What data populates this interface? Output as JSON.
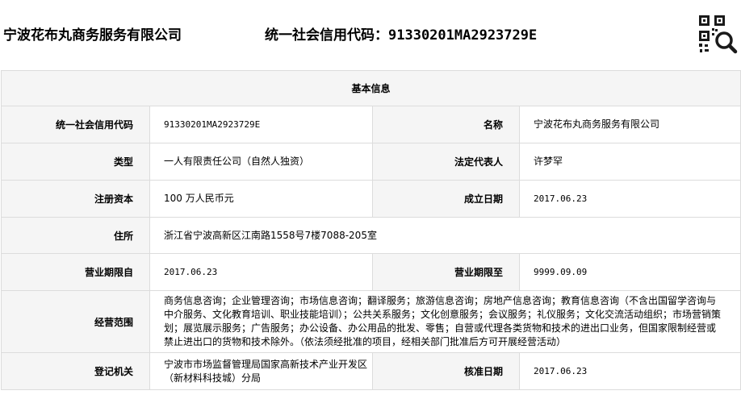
{
  "header": {
    "company_name": "宁波花布丸商务服务有限公司",
    "credit_label": "统一社会信用代码：",
    "credit_code": "91330201MA2923729E",
    "qr_icon": "qr-code-search-icon"
  },
  "table": {
    "title": "基本信息",
    "credit_code": {
      "label": "统一社会信用代码",
      "value": "91330201MA2923729E"
    },
    "name": {
      "label": "名称",
      "value": "宁波花布丸商务服务有限公司"
    },
    "type": {
      "label": "类型",
      "value": "一人有限责任公司（自然人独资）"
    },
    "legal_rep": {
      "label": "法定代表人",
      "value": "许梦罕"
    },
    "reg_capital": {
      "label": "注册资本",
      "value": "100 万人民币元"
    },
    "founded": {
      "label": "成立日期",
      "value": "2017.06.23"
    },
    "address": {
      "label": "住所",
      "value": "浙江省宁波高新区江南路1558号7楼7088-205室"
    },
    "term_from": {
      "label": "营业期限自",
      "value": "2017.06.23"
    },
    "term_to": {
      "label": "营业期限至",
      "value": "9999.09.09"
    },
    "scope": {
      "label": "经营范围",
      "value": "商务信息咨询；企业管理咨询；市场信息咨询；翻译服务；旅游信息咨询；房地产信息咨询；教育信息咨询（不含出国留学咨询与中介服务、文化教育培训、职业技能培训）；公共关系服务；文化创意服务；会议服务；礼仪服务；文化交流活动组织；市场营销策划；展览展示服务；广告服务；办公设备、办公用品的批发、零售；自营或代理各类货物和技术的进出口业务，但国家限制经营或禁止进出口的货物和技术除外。（依法须经批准的项目，经相关部门批准后方可开展经营活动）"
    },
    "authority": {
      "label": "登记机关",
      "value": "宁波市市场监督管理局国家高新技术产业开发区（新材料科技城）分局"
    },
    "approval_date": {
      "label": "核准日期",
      "value": "2017.06.23"
    }
  }
}
